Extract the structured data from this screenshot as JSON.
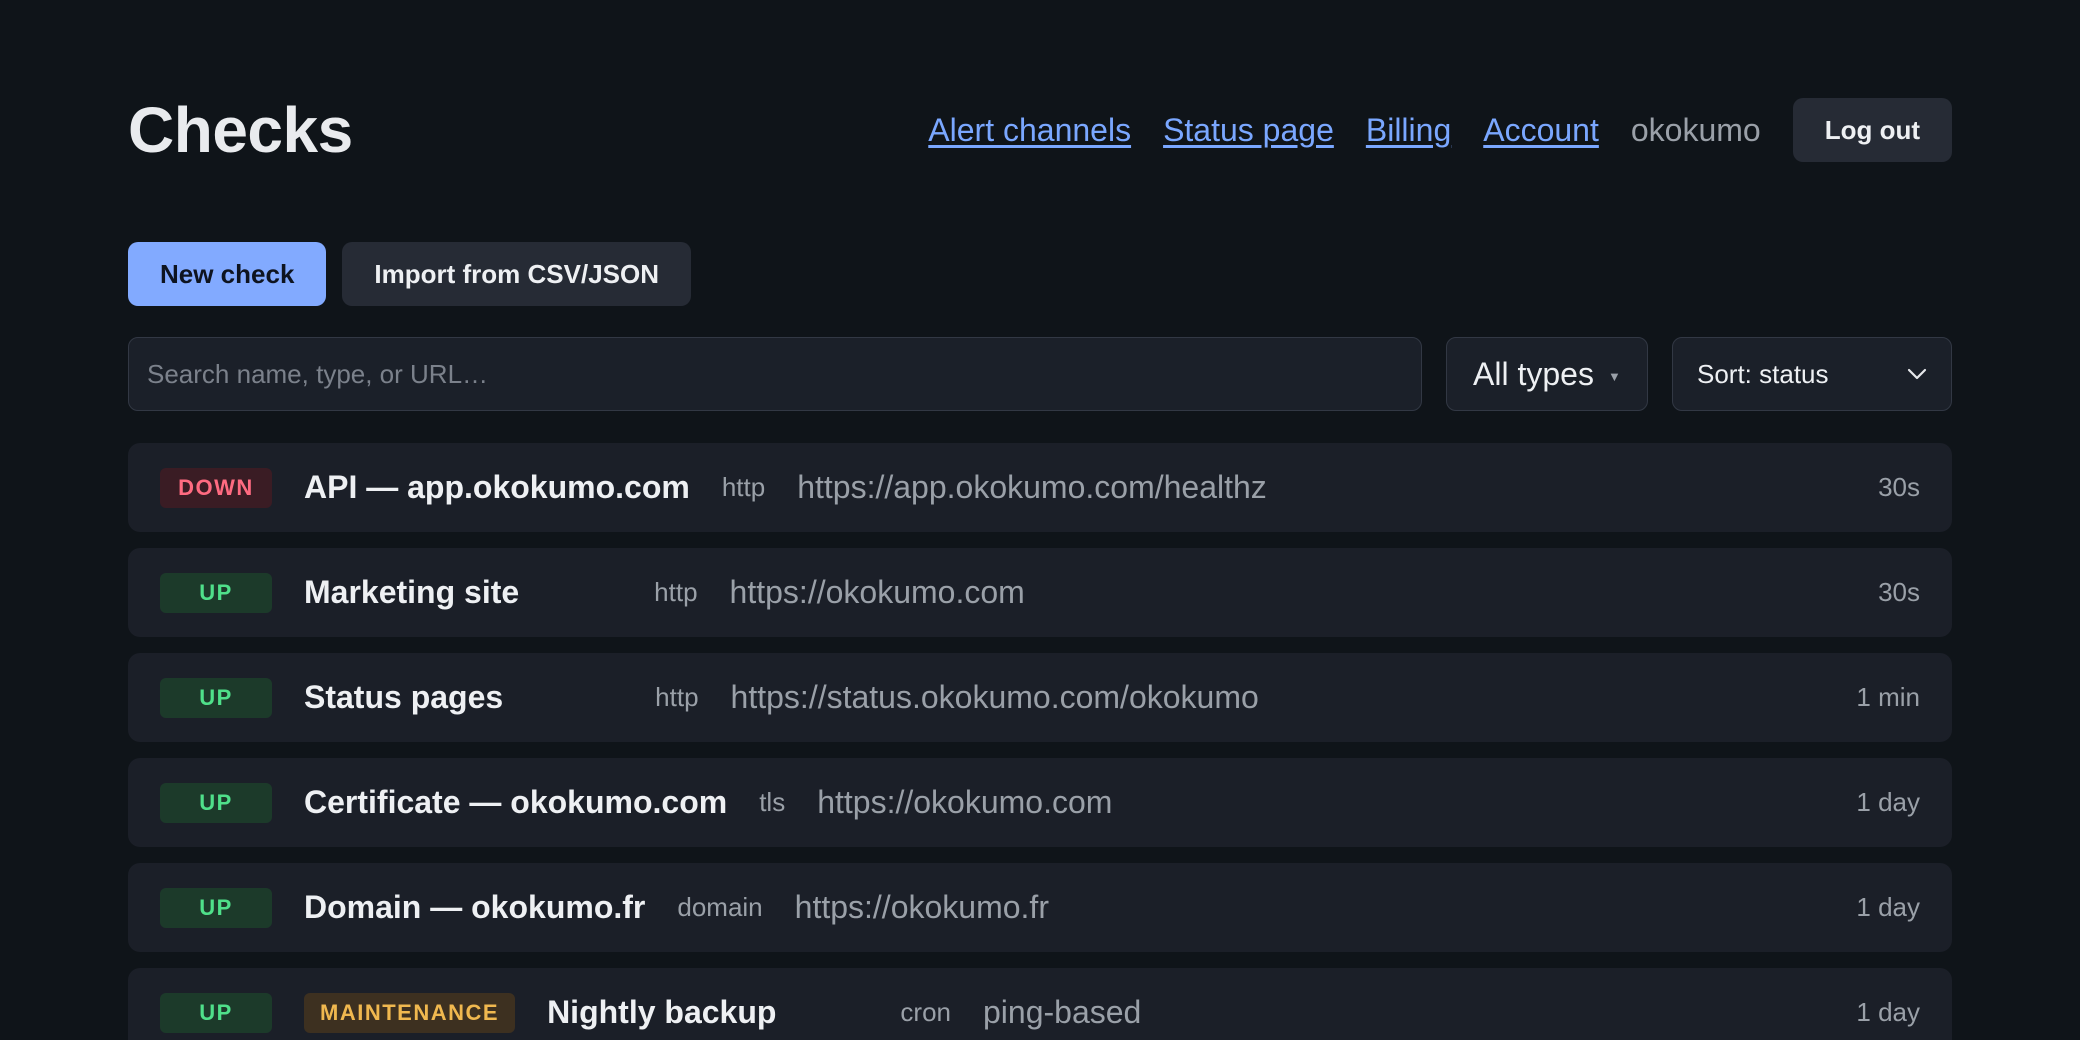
{
  "header": {
    "title": "Checks",
    "nav": [
      "Alert channels",
      "Status page",
      "Billing",
      "Account"
    ],
    "username": "okokumo",
    "logout_label": "Log out"
  },
  "actions": {
    "new_check_label": "New check",
    "import_label": "Import from CSV/JSON"
  },
  "filters": {
    "search_placeholder": "Search name, type, or URL…",
    "type_filter": "All types",
    "sort": "Sort: status"
  },
  "colors": {
    "background": "#0f1419",
    "accent": "#82aaff",
    "link": "#7aa7ff",
    "status_down": "#ff6b81",
    "status_up": "#4fe08a",
    "status_maintenance": "#f0b84f"
  },
  "checks": [
    {
      "status": "DOWN",
      "name": "API — app.okokumo.com",
      "type": "http",
      "url": "https://app.okokumo.com/healthz",
      "interval": "30s"
    },
    {
      "status": "UP",
      "name": "Marketing site",
      "type": "http",
      "url": "https://okokumo.com",
      "interval": "30s"
    },
    {
      "status": "UP",
      "name": "Status pages",
      "type": "http",
      "url": "https://status.okokumo.com/okokumo",
      "interval": "1 min"
    },
    {
      "status": "UP",
      "name": "Certificate — okokumo.com",
      "type": "tls",
      "url": "https://okokumo.com",
      "interval": "1 day"
    },
    {
      "status": "UP",
      "name": "Domain — okokumo.fr",
      "type": "domain",
      "url": "https://okokumo.fr",
      "interval": "1 day"
    },
    {
      "status": "UP",
      "extra_badge": "MAINTENANCE",
      "name": "Nightly backup",
      "type": "cron",
      "url": "ping-based",
      "interval": "1 day"
    }
  ]
}
